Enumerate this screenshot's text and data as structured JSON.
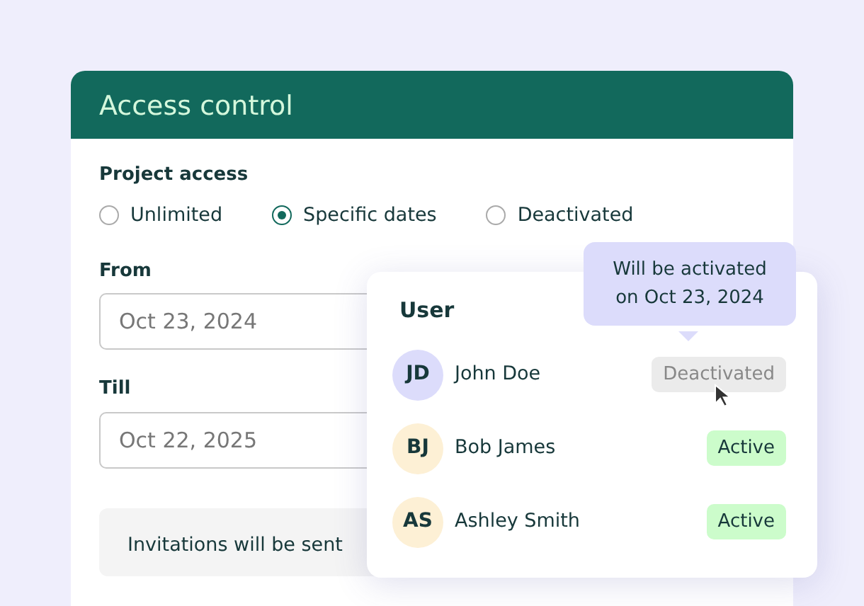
{
  "card": {
    "title": "Access control"
  },
  "project_access": {
    "label": "Project access",
    "options": [
      {
        "label": "Unlimited",
        "selected": false
      },
      {
        "label": "Specific dates",
        "selected": true
      },
      {
        "label": "Deactivated",
        "selected": false
      }
    ]
  },
  "fields": [
    {
      "label": "From",
      "placeholder": "Oct 23, 2024"
    },
    {
      "label": "Till",
      "placeholder": "Oct 22, 2025"
    }
  ],
  "notice": "Invitations will be sent",
  "popup": {
    "heading": "User",
    "tooltip": "Will be activated on Oct 23, 2024",
    "users": [
      {
        "initials": "JD",
        "name": "John Doe",
        "status": "Deactivated",
        "active": false,
        "color": "#dcdcfb"
      },
      {
        "initials": "BJ",
        "name": "Bob James",
        "status": "Active",
        "active": true,
        "color": "#fdf0d5"
      },
      {
        "initials": "AS",
        "name": "Ashley Smith",
        "status": "Active",
        "active": true,
        "color": "#fdf0d5"
      }
    ]
  }
}
